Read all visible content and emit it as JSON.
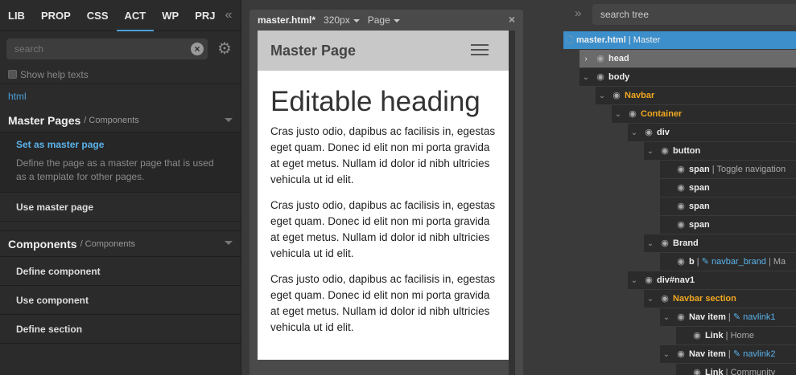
{
  "left": {
    "tabs": [
      "LIB",
      "PROP",
      "CSS",
      "ACT",
      "WP",
      "PRJ"
    ],
    "collapse": "«",
    "search_placeholder": "search",
    "help_label": "Show help texts",
    "crumb": "html",
    "sections": [
      {
        "title": "Master Pages",
        "sub": "/ Components",
        "items": [
          {
            "label": "Set as master page",
            "desc": "Define the page as a master page that is used as a template for other pages."
          },
          {
            "label": "Use master page"
          }
        ]
      },
      {
        "title": "Components",
        "sub": "/ Components",
        "items": [
          {
            "label": "Define component"
          },
          {
            "label": "Use component"
          },
          {
            "label": "Define section"
          }
        ]
      }
    ]
  },
  "center": {
    "doc": "master.html*",
    "size": "320px",
    "mode": "Page",
    "close": "×",
    "brand": "Master Page",
    "heading": "Editable heading",
    "paragraphs": [
      "Cras justo odio, dapibus ac facilisis in, egestas eget quam. Donec id elit non mi porta gravida at eget metus. Nullam id dolor id nibh ultricies vehicula ut id elit.",
      "Cras justo odio, dapibus ac facilisis in, egestas eget quam. Donec id elit non mi porta gravida at eget metus. Nullam id dolor id nibh ultricies vehicula ut id elit.",
      "Cras justo odio, dapibus ac facilisis in, egestas eget quam. Donec id elit non mi porta gravida at eget metus. Nullam id dolor id nibh ultricies vehicula ut id elit."
    ]
  },
  "tree": {
    "search_placeholder": "search tree",
    "expand": "»",
    "rows": [
      {
        "name": "master.html",
        "sep": " | ",
        "sub": "Master"
      },
      {
        "name": "head"
      },
      {
        "name": "body"
      },
      {
        "name": "Navbar"
      },
      {
        "name": "Container"
      },
      {
        "name": "div"
      },
      {
        "name": "button"
      },
      {
        "name": "span",
        "sep": " | ",
        "sub": "Toggle navigation"
      },
      {
        "name": "span"
      },
      {
        "name": "span"
      },
      {
        "name": "span"
      },
      {
        "name": "Brand"
      },
      {
        "name": "b",
        "sep": " | ",
        "lnk": "✎ navbar_brand",
        "sub": " | Ma"
      },
      {
        "name": "div#nav1"
      },
      {
        "name": "Navbar section"
      },
      {
        "name": "Nav item",
        "sep": " | ",
        "lnk": "✎ navlink1"
      },
      {
        "name": "Link",
        "sep": " | ",
        "sub": "Home"
      },
      {
        "name": "Nav item",
        "sep": " | ",
        "lnk": "✎ navlink2"
      },
      {
        "name": "Link",
        "sep": " | ",
        "sub": "Community"
      }
    ]
  }
}
